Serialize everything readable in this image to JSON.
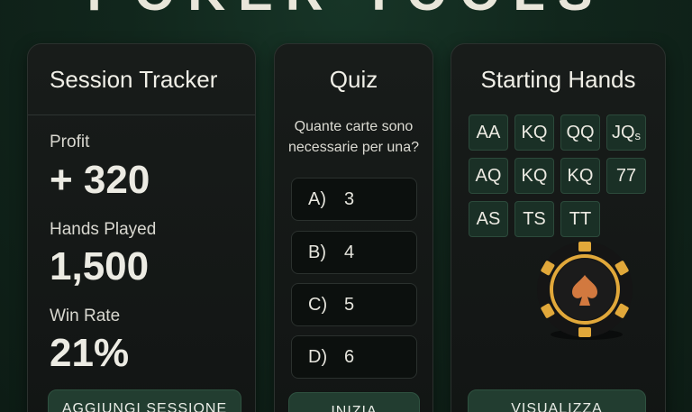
{
  "header": {
    "title": "POKER TOOLS"
  },
  "session": {
    "title": "Session Tracker",
    "stats": [
      {
        "label": "Profit",
        "value": "+ 320"
      },
      {
        "label": "Hands Played",
        "value": "1,500"
      },
      {
        "label": "Win Rate",
        "value": "21%"
      }
    ],
    "button_label": "AGGIUNGI SESSIONE"
  },
  "quiz": {
    "title": "Quiz",
    "question": "Quante carte sono necessarie per una?",
    "answers": [
      {
        "letter": "A)",
        "value": "3"
      },
      {
        "letter": "B)",
        "value": "4"
      },
      {
        "letter": "C)",
        "value": "5"
      },
      {
        "letter": "D)",
        "value": "6"
      }
    ],
    "button_label": "INIZIA"
  },
  "hands": {
    "title": "Starting Hands",
    "grid": [
      {
        "text": "AA",
        "suffix": ""
      },
      {
        "text": "KQ",
        "suffix": ""
      },
      {
        "text": "QQ",
        "suffix": ""
      },
      {
        "text": "JQ",
        "suffix": "s"
      },
      {
        "text": "AQ",
        "suffix": ""
      },
      {
        "text": "KQ",
        "suffix": ""
      },
      {
        "text": "KQ",
        "suffix": ""
      },
      {
        "text": "77",
        "suffix": ""
      },
      {
        "text": "AS",
        "suffix": ""
      },
      {
        "text": "TS",
        "suffix": ""
      },
      {
        "text": "TT",
        "suffix": ""
      }
    ],
    "chip_icon": "poker-chip-spade-icon",
    "button_label": "VISUALIZZA"
  },
  "colors": {
    "background": "#11261c",
    "card": "#151917",
    "button": "#223d30",
    "chip_gold": "#e1a83a",
    "chip_spade": "#d2793f"
  }
}
